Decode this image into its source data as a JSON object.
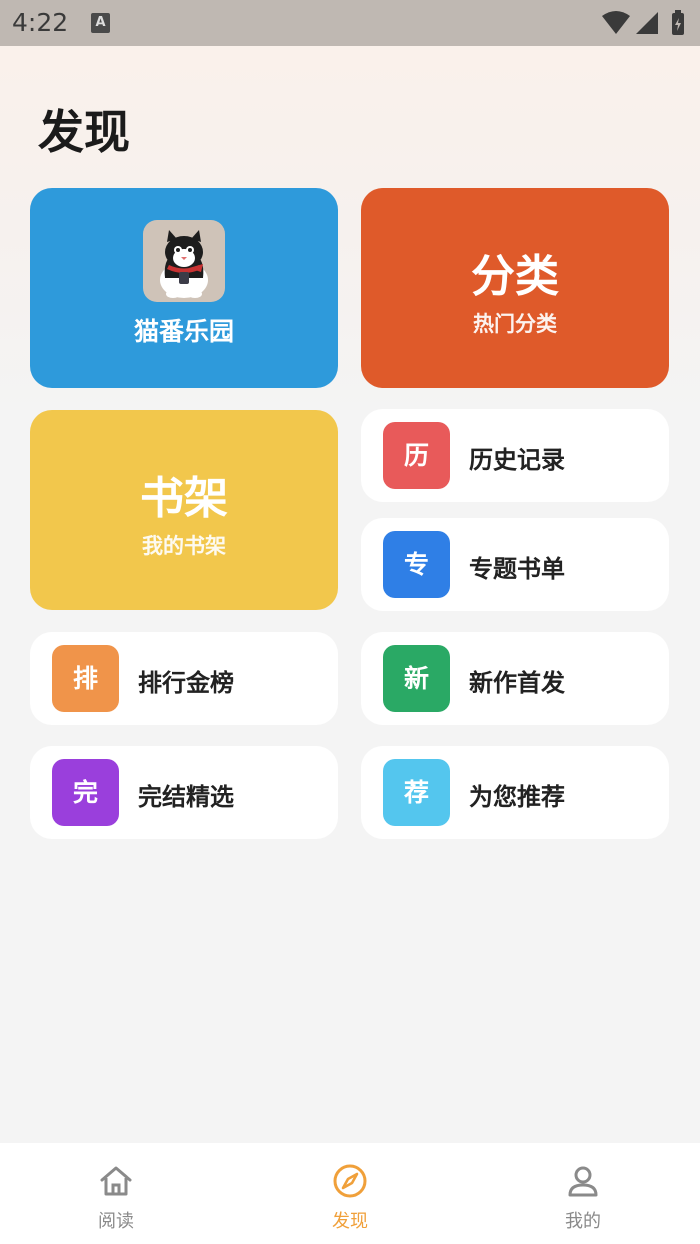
{
  "status_bar": {
    "time": "4:22",
    "a_icon": "A"
  },
  "header": {
    "title": "发现"
  },
  "cards": {
    "cats": {
      "label": "猫番乐园",
      "image": "cat-avatar"
    },
    "category": {
      "title": "分类",
      "subtitle": "热门分类",
      "color": "#df5a2a"
    },
    "shelf": {
      "title": "书架",
      "subtitle": "我的书架",
      "color": "#f2c74c"
    }
  },
  "tiles": [
    {
      "badge": "历",
      "label": "历史记录",
      "color": "#e85a5a"
    },
    {
      "badge": "专",
      "label": "专题书单",
      "color": "#2f7fe6"
    },
    {
      "badge": "排",
      "label": "排行金榜",
      "color": "#f0944a"
    },
    {
      "badge": "新",
      "label": "新作首发",
      "color": "#2aa965"
    },
    {
      "badge": "完",
      "label": "完结精选",
      "color": "#9a3fdc"
    },
    {
      "badge": "荐",
      "label": "为您推荐",
      "color": "#54c6ee"
    }
  ],
  "bottom_nav": {
    "items": [
      {
        "label": "阅读",
        "icon": "home-icon",
        "active": false
      },
      {
        "label": "发现",
        "icon": "compass-icon",
        "active": true
      },
      {
        "label": "我的",
        "icon": "person-icon",
        "active": false
      }
    ],
    "active_color": "#f0a03a"
  }
}
